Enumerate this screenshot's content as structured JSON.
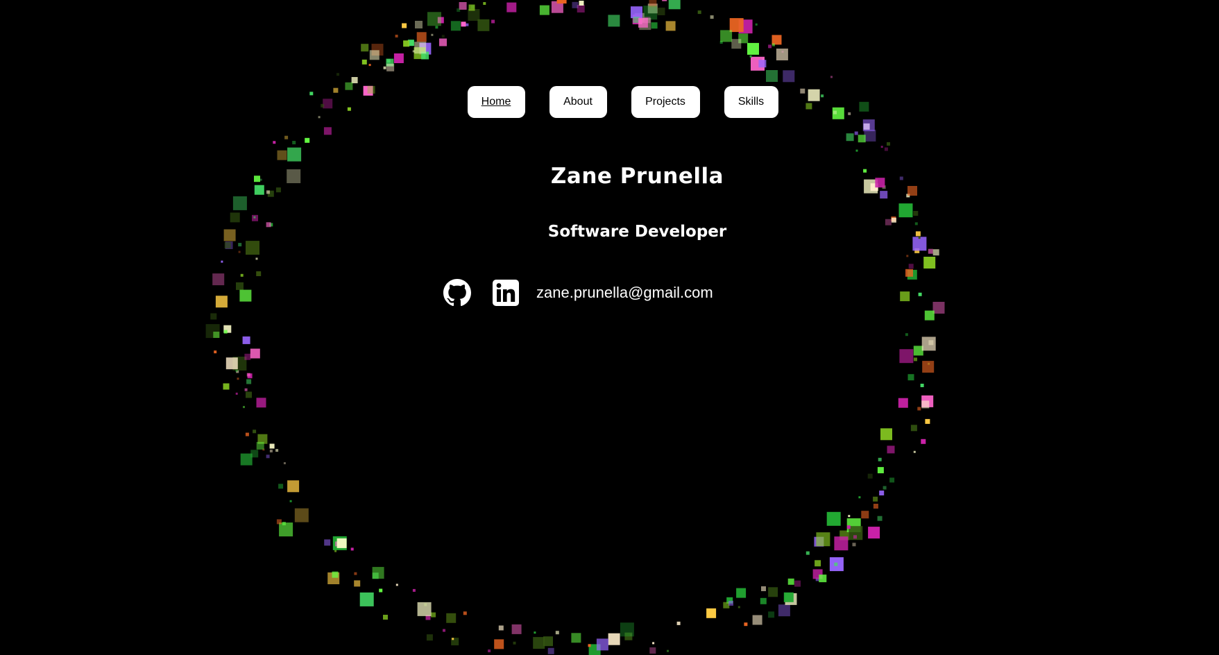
{
  "nav": {
    "items": [
      {
        "label": "Home",
        "active": true
      },
      {
        "label": "About",
        "active": false
      },
      {
        "label": "Projects",
        "active": false
      },
      {
        "label": "Skills",
        "active": false
      }
    ]
  },
  "hero": {
    "name": "Zane Prunella",
    "role": "Software Developer"
  },
  "contact": {
    "github_icon": "github-icon",
    "linkedin_icon": "linkedin-icon",
    "email": "zane.prunella@gmail.com"
  },
  "background": {
    "effect": "colored pixel particles in a ring",
    "colors": [
      "#66ff44",
      "#ffffcc",
      "#ff66cc",
      "#22aa33",
      "#88cc22",
      "#ffcc44",
      "#ee6622",
      "#cc22aa",
      "#9966ff",
      "#335511",
      "#ffeecc",
      "#44dd66"
    ]
  }
}
